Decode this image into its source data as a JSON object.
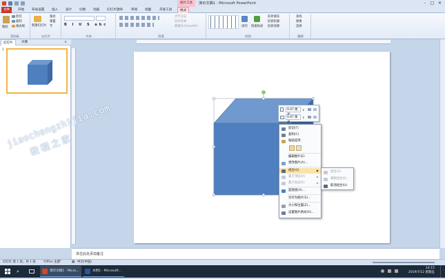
{
  "window": {
    "title": "演示文稿1 - Microsoft PowerPoint",
    "context_tab_top": "图片工具",
    "controls": [
      "minimize-icon",
      "maximize-icon",
      "close-icon"
    ]
  },
  "ribbon_tabs": [
    "文件",
    "开始",
    "布局设置",
    "插入",
    "设计",
    "切换",
    "动画",
    "幻灯片放映",
    "审阅",
    "视图",
    "开发工具",
    "格式"
  ],
  "ribbon": {
    "clipboard": {
      "label": "剪贴板",
      "paste": "粘贴",
      "cut": "剪切",
      "copy": "复制",
      "format_painter": "格式刷"
    },
    "slides": {
      "label": "幻灯片",
      "new_slide": "新建幻灯片",
      "layout": "版式",
      "reset": "重置",
      "section": "节"
    },
    "font": {
      "label": "字体"
    },
    "paragraph": {
      "label": "段落",
      "text_direction": "文字方向",
      "align_text": "对齐文本",
      "smartart": "转换为 SmartArt"
    },
    "drawing": {
      "label": "绘图",
      "arrange": "排列",
      "quick_styles": "快速样式",
      "shape_fill": "形状填充",
      "shape_outline": "形状轮廓",
      "shape_effects": "形状效果"
    },
    "editing": {
      "label": "编辑",
      "find": "查找",
      "replace": "替换",
      "select": "选择"
    }
  },
  "left_pane": {
    "tab_slides": "幻灯片",
    "tab_outline": "大纲",
    "close": "×",
    "slide_number": "1"
  },
  "mini_toolbar": {
    "height_value": "9.87 厘米",
    "width_value": "9.87 厘米"
  },
  "context_menu": [
    {
      "label": "剪切(T)",
      "icon": "cut-icon",
      "disabled": false
    },
    {
      "label": "复制(C)",
      "icon": "copy-icon",
      "disabled": false
    },
    {
      "label": "粘贴选项:",
      "icon": "paste-icon",
      "disabled": false
    },
    {
      "label": "编辑图片(E)",
      "icon": "",
      "disabled": false
    },
    {
      "label": "更改图片(A)...",
      "icon": "change-picture-icon",
      "disabled": false
    },
    {
      "label": "组合(G)",
      "icon": "group-icon",
      "disabled": false,
      "submenu": true,
      "highlighted": true
    },
    {
      "label": "置于顶层(R)",
      "icon": "bring-front-icon",
      "disabled": true,
      "submenu": true
    },
    {
      "label": "置于底层(K)",
      "icon": "send-back-icon",
      "disabled": true,
      "submenu": true
    },
    {
      "label": "超链接(H)...",
      "icon": "hyperlink-icon",
      "disabled": false
    },
    {
      "label": "另存为图片(S)...",
      "icon": "",
      "disabled": false
    },
    {
      "label": "大小和位置(Z)...",
      "icon": "size-icon",
      "disabled": false
    },
    {
      "label": "设置图片格式(O)...",
      "icon": "format-picture-icon",
      "disabled": false
    }
  ],
  "submenu": [
    {
      "label": "组合(G)",
      "disabled": true
    },
    {
      "label": "重新组合(E)",
      "disabled": true
    },
    {
      "label": "取消组合(U)",
      "disabled": false
    }
  ],
  "notes_placeholder": "单击此处添加备注",
  "status_bar": {
    "slide_info": "幻灯片 第 1 张，共 1 张",
    "theme": "\"Office 主题\"",
    "language": "中文(中国)"
  },
  "taskbar": {
    "apps": [
      {
        "label": "演示文稿1 - Micro...",
        "color": "#d24726"
      },
      {
        "label": "文档1 - Microsoft...",
        "color": "#2b579a"
      }
    ],
    "time": "14:15",
    "date": "2019/7/12 星期五"
  },
  "watermark": {
    "line1": "jiaochengzhijia.com",
    "line2": "教程之家"
  },
  "colors": {
    "cube_front": "#4f7fbf",
    "cube_top": "#6f99cf",
    "cube_side": "#3e6aa6",
    "accent_file_tab": "#c8372d",
    "highlight": "#fbe3a8"
  }
}
